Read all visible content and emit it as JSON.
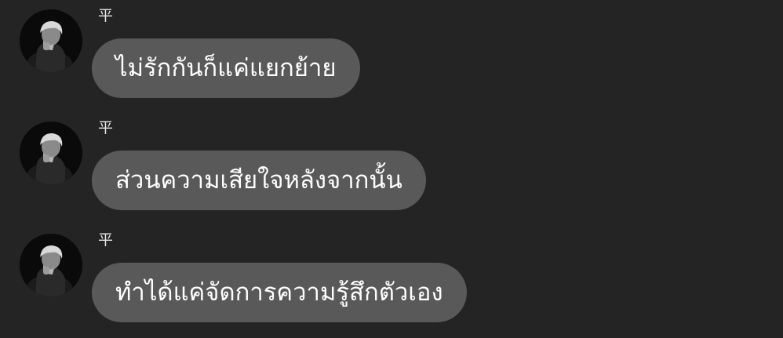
{
  "messages": [
    {
      "sender": "平",
      "text": "ไม่รักกันก็แค่แยกย้าย",
      "avatar_icon": "profile-photo"
    },
    {
      "sender": "平",
      "text": "ส่วนความเสียใจหลังจากนั้น",
      "avatar_icon": "profile-photo"
    },
    {
      "sender": "平",
      "text": "ทำได้แค่จัดการความรู้สึกตัวเอง",
      "avatar_icon": "profile-photo"
    }
  ],
  "colors": {
    "background": "#242424",
    "bubble": "#595959",
    "text": "#ffffff",
    "sender": "#e6e6e6"
  }
}
